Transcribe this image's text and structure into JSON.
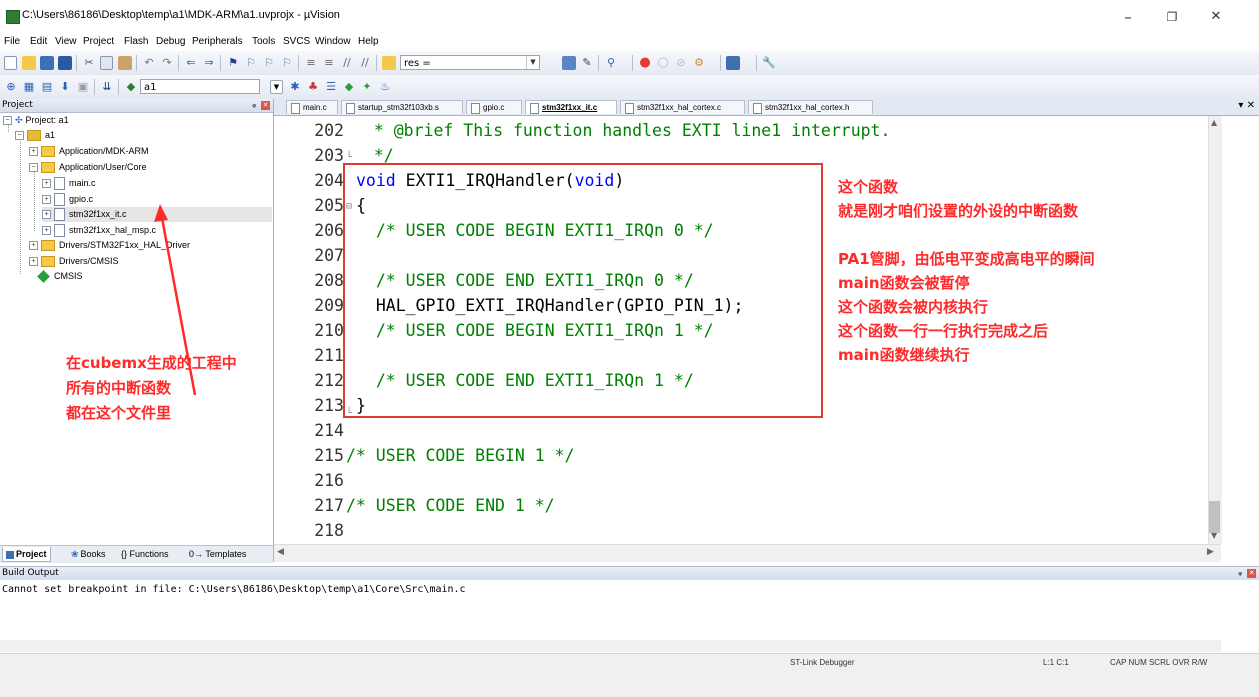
{
  "window": {
    "title": "C:\\Users\\86186\\Desktop\\temp\\a1\\MDK-ARM\\a1.uvprojx - µVision",
    "min": "–",
    "max": "❐",
    "close": "✕"
  },
  "menu": [
    "File",
    "Edit",
    "View",
    "Project",
    "Flash",
    "Debug",
    "Peripherals",
    "Tools",
    "SVCS",
    "Window",
    "Help"
  ],
  "toolbar": {
    "find_combo": "res =",
    "target_combo": "a1"
  },
  "project_panel": {
    "title": "Project",
    "pin": "ᵩ",
    "tree": [
      {
        "label": "Project: a1",
        "type": "root"
      },
      {
        "label": "a1",
        "type": "target"
      },
      {
        "label": "Application/MDK-ARM",
        "type": "folder"
      },
      {
        "label": "Application/User/Core",
        "type": "folder"
      },
      {
        "label": "main.c",
        "type": "file"
      },
      {
        "label": "gpio.c",
        "type": "file"
      },
      {
        "label": "stm32f1xx_it.c",
        "type": "file"
      },
      {
        "label": "stm32f1xx_hal_msp.c",
        "type": "file"
      },
      {
        "label": "Drivers/STM32F1xx_HAL_Driver",
        "type": "folder"
      },
      {
        "label": "Drivers/CMSIS",
        "type": "folder"
      },
      {
        "label": "CMSIS",
        "type": "component"
      }
    ],
    "tabs": [
      "Project",
      "Books",
      "{} Functions",
      "0→ Templates"
    ]
  },
  "editor": {
    "tabs": [
      {
        "label": "main.c",
        "active": false
      },
      {
        "label": "startup_stm32f103xb.s",
        "active": false
      },
      {
        "label": "gpio.c",
        "active": false
      },
      {
        "label": "stm32f1xx_it.c",
        "active": true
      },
      {
        "label": "stm32f1xx_hal_cortex.c",
        "active": false
      },
      {
        "label": "stm32f1xx_hal_cortex.h",
        "active": false
      }
    ],
    "lines": [
      {
        "n": "202",
        "code": "  * @brief This function handles EXTI line1 interrupt."
      },
      {
        "n": "203",
        "code": "  */"
      },
      {
        "n": "204",
        "code": "void EXTI1_IRQHandler(void)"
      },
      {
        "n": "205",
        "code": "{"
      },
      {
        "n": "206",
        "code": "  /* USER CODE BEGIN EXTI1_IRQn 0 */"
      },
      {
        "n": "207",
        "code": ""
      },
      {
        "n": "208",
        "code": "  /* USER CODE END EXTI1_IRQn 0 */"
      },
      {
        "n": "209",
        "code": "  HAL_GPIO_EXTI_IRQHandler(GPIO_PIN_1);"
      },
      {
        "n": "210",
        "code": "  /* USER CODE BEGIN EXTI1_IRQn 1 */"
      },
      {
        "n": "211",
        "code": ""
      },
      {
        "n": "212",
        "code": "  /* USER CODE END EXTI1_IRQn 1 */"
      },
      {
        "n": "213",
        "code": "}"
      },
      {
        "n": "214",
        "code": ""
      },
      {
        "n": "215",
        "code": "/* USER CODE BEGIN 1 */"
      },
      {
        "n": "216",
        "code": ""
      },
      {
        "n": "217",
        "code": "/* USER CODE END 1 */"
      },
      {
        "n": "218",
        "code": ""
      }
    ]
  },
  "annotations": {
    "right": [
      "这个函数",
      "就是刚才咱们设置的外设的中断函数",
      "PA1管脚，由低电平变成高电平的瞬间",
      "main函数会被暂停",
      "这个函数会被内核执行",
      "这个函数一行一行执行完成之后",
      "main函数继续执行"
    ],
    "left": [
      "在cubemx生成的工程中",
      "所有的中断函数",
      "都在这个文件里"
    ]
  },
  "build_output": {
    "title": "Build Output",
    "text": "Cannot set breakpoint in file: C:\\Users\\86186\\Desktop\\temp\\a1\\Core\\Src\\main.c"
  },
  "status": {
    "debugger": "ST-Link Debugger",
    "position": "L:1 C:1",
    "indicators": "CAP  NUM  SCRL  OVR  R/W"
  },
  "colors": {
    "keyword": "#0000ff",
    "comment": "#008000",
    "annotation": "#ff2a2a"
  }
}
